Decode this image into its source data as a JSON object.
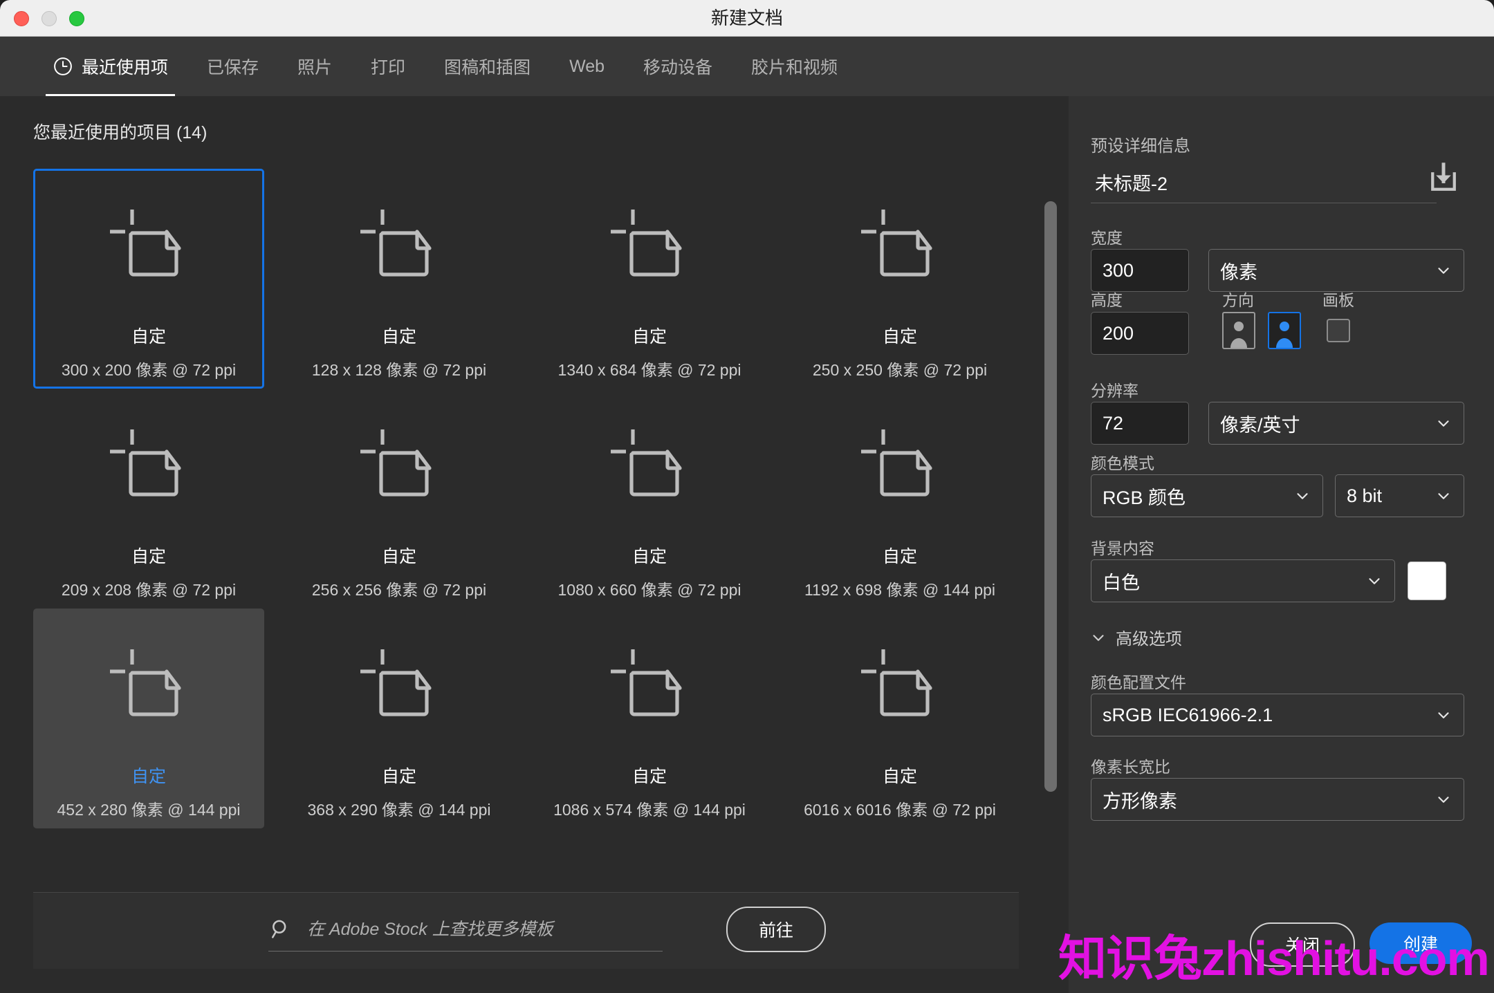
{
  "window": {
    "title": "新建文档",
    "traffic_lights": [
      {
        "name": "close",
        "color": "#ff5f57"
      },
      {
        "name": "minimize",
        "color": "#dddddd"
      },
      {
        "name": "zoom",
        "color": "#28c840"
      }
    ]
  },
  "tabs": [
    {
      "label": "最近使用项",
      "icon": "clock-icon",
      "active": true
    },
    {
      "label": "已保存",
      "active": false
    },
    {
      "label": "照片",
      "active": false
    },
    {
      "label": "打印",
      "active": false
    },
    {
      "label": "图稿和插图",
      "active": false
    },
    {
      "label": "Web",
      "active": false
    },
    {
      "label": "移动设备",
      "active": false
    },
    {
      "label": "胶片和视频",
      "active": false
    }
  ],
  "recent": {
    "heading": "您最近使用的项目 (14)",
    "items": [
      {
        "name": "自定",
        "size": "300 x 200 像素 @ 72 ppi",
        "state": "selected"
      },
      {
        "name": "自定",
        "size": "128 x 128 像素 @ 72 ppi",
        "state": "normal"
      },
      {
        "name": "自定",
        "size": "1340 x 684 像素 @ 72 ppi",
        "state": "normal"
      },
      {
        "name": "自定",
        "size": "250 x 250 像素 @ 72 ppi",
        "state": "normal"
      },
      {
        "name": "自定",
        "size": "209 x 208 像素 @ 72 ppi",
        "state": "normal"
      },
      {
        "name": "自定",
        "size": "256 x 256 像素 @ 72 ppi",
        "state": "normal"
      },
      {
        "name": "自定",
        "size": "1080 x 660 像素 @ 72 ppi",
        "state": "normal"
      },
      {
        "name": "自定",
        "size": "1192 x 698 像素 @ 144 ppi",
        "state": "normal"
      },
      {
        "name": "自定",
        "size": "452 x 280 像素 @ 144 ppi",
        "state": "hovered"
      },
      {
        "name": "自定",
        "size": "368 x 290 像素 @ 144 ppi",
        "state": "normal"
      },
      {
        "name": "自定",
        "size": "1086 x 574 像素 @ 144 ppi",
        "state": "normal"
      },
      {
        "name": "自定",
        "size": "6016 x 6016 像素 @ 72 ppi",
        "state": "normal"
      }
    ]
  },
  "stock": {
    "placeholder": "在 Adobe Stock 上查找更多模板",
    "value": "",
    "goto_label": "前往",
    "search_icon": "search-icon"
  },
  "panel": {
    "title": "预设详细信息",
    "doc_name": "未标题-2",
    "save_preset_icon": "download-preset-icon",
    "width": {
      "label": "宽度",
      "value": "300",
      "unit": "像素"
    },
    "height": {
      "label": "高度",
      "value": "200"
    },
    "orientation": {
      "label": "方向",
      "portrait": {
        "name": "portrait-orientation",
        "selected": false
      },
      "landscape": {
        "name": "landscape-orientation",
        "selected": true
      }
    },
    "artboard": {
      "label": "画板",
      "checked": false
    },
    "resolution": {
      "label": "分辨率",
      "value": "72",
      "unit": "像素/英寸"
    },
    "color_mode": {
      "label": "颜色模式",
      "value": "RGB 颜色",
      "depth": "8 bit"
    },
    "background": {
      "label": "背景内容",
      "value": "白色",
      "swatch": "#ffffff"
    },
    "advanced": {
      "label": "高级选项",
      "expanded": true
    },
    "color_profile": {
      "label": "颜色配置文件",
      "value": "sRGB IEC61966-2.1"
    },
    "pixel_aspect": {
      "label": "像素长宽比",
      "value": "方形像素"
    }
  },
  "footer": {
    "close_label": "关闭",
    "create_label": "创建",
    "accent": "#1473e6"
  },
  "watermark": {
    "text": "知识兔zhishitu.com",
    "color": "#e211e2"
  }
}
